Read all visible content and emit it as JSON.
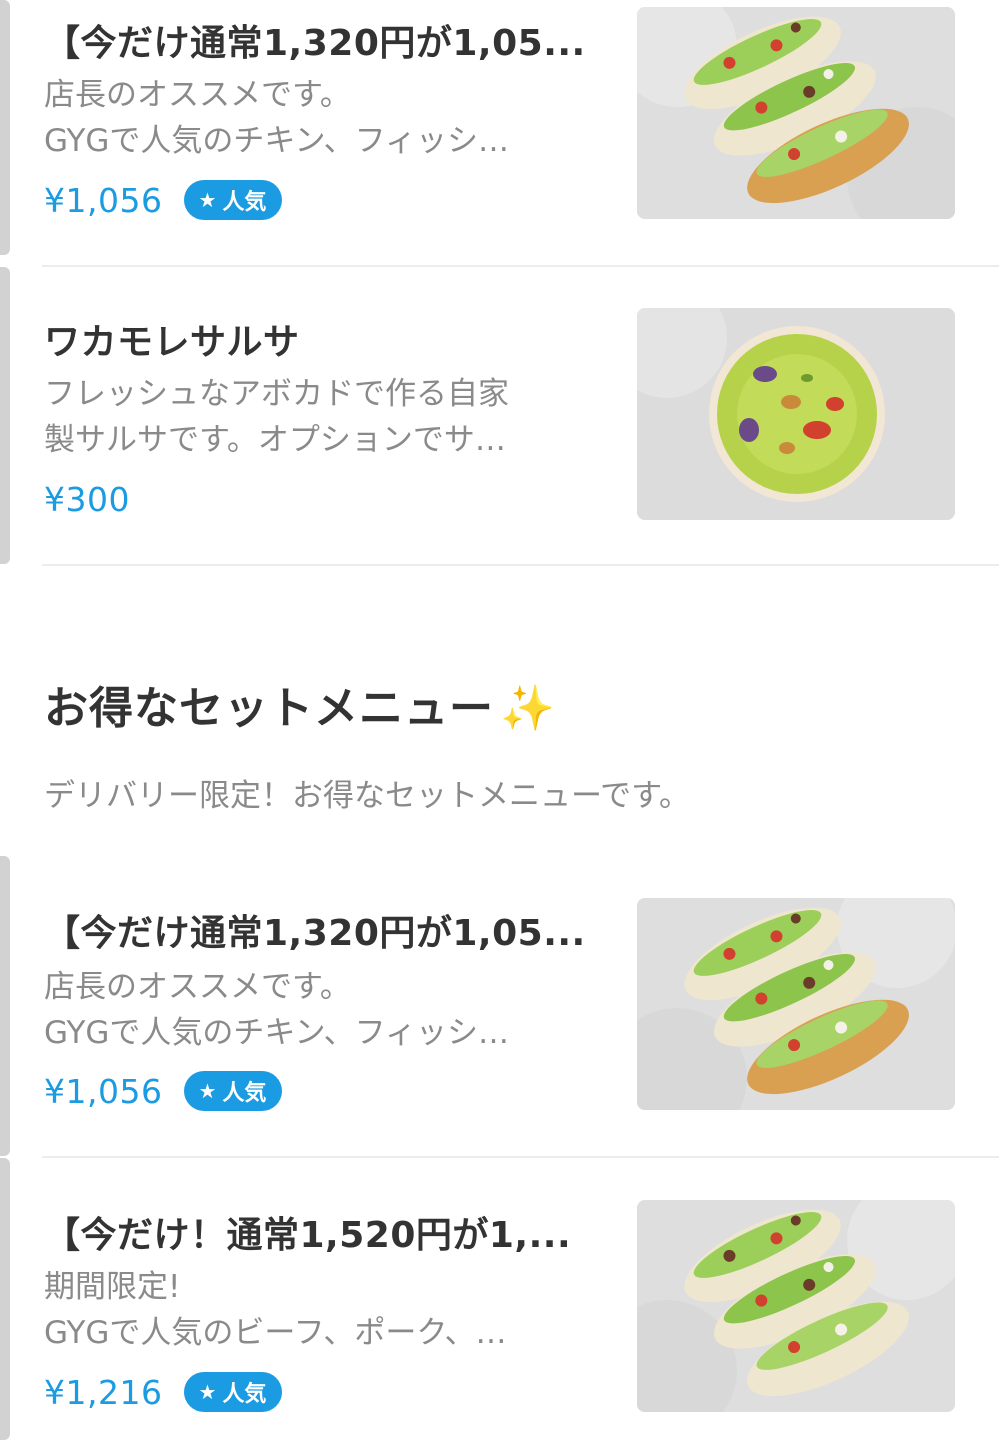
{
  "items_top": [
    {
      "title": "【今だけ通常1,320円が1,05...",
      "desc_lines": [
        "店長のオススメです。",
        "GYGで人気のチキン、フィッシ…"
      ],
      "price": "¥1,056",
      "badge": "人気",
      "image": "tacos-image"
    },
    {
      "title": "ワカモレサルサ",
      "desc_lines": [
        "フレッシュなアボカドで作る自家",
        "製サルサです。オプションでサ…"
      ],
      "price": "¥300",
      "image": "guacamole-image"
    }
  ],
  "section": {
    "title": "お得なセットメニュー",
    "title_emoji": "✨",
    "description": "デリバリー限定！お得なセットメニューです。"
  },
  "items_set": [
    {
      "title": "【今だけ通常1,320円が1,05...",
      "desc_lines": [
        "店長のオススメです。",
        "GYGで人気のチキン、フィッシ…"
      ],
      "price": "¥1,056",
      "badge": "人気",
      "image": "tacos-image"
    },
    {
      "title": "【今だけ！通常1,520円が1,...",
      "desc_lines": [
        "期間限定!",
        "GYGで人気のビーフ、ポーク、…"
      ],
      "price": "¥1,216",
      "badge": "人気",
      "image": "tacos-image"
    }
  ],
  "colors": {
    "price": "#1a9be2",
    "badge_bg": "#1a9be2",
    "title": "#333333",
    "desc": "#8a8a8a",
    "divider": "#ececec"
  }
}
